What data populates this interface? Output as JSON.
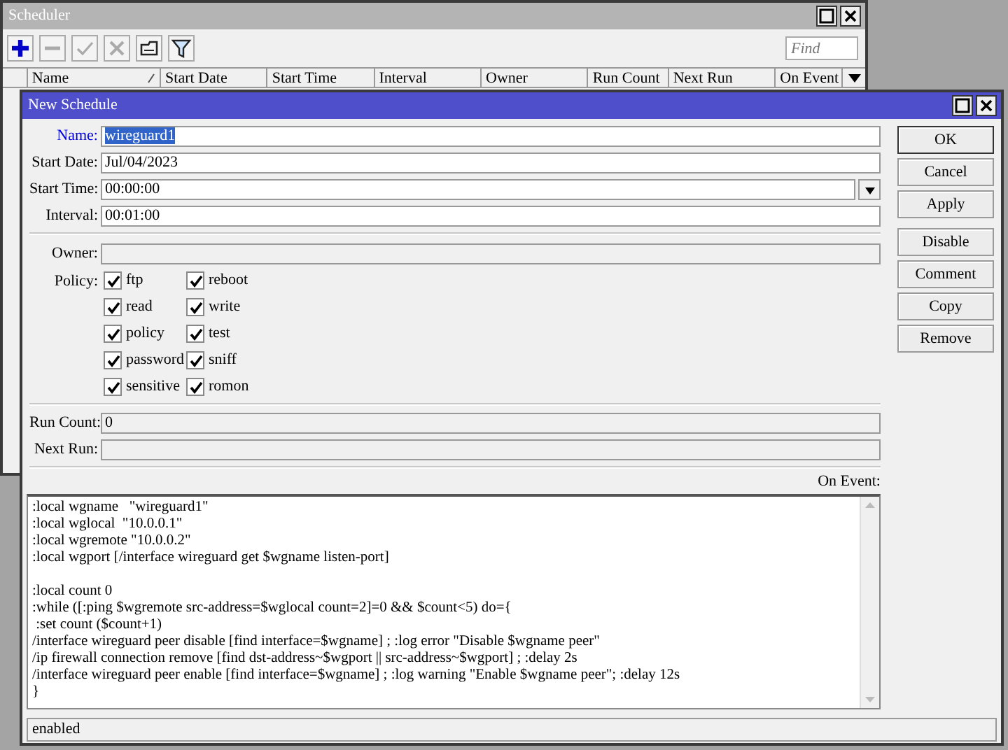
{
  "scheduler": {
    "title": "Scheduler",
    "toolbar": [
      {
        "kind": "add",
        "disabled": false
      },
      {
        "kind": "remove",
        "disabled": true
      },
      {
        "kind": "enable",
        "disabled": true
      },
      {
        "kind": "disable",
        "disabled": true
      },
      {
        "kind": "comment",
        "disabled": false
      },
      {
        "kind": "filter",
        "disabled": false
      }
    ],
    "search": {
      "placeholder": "Find"
    },
    "columns": [
      {
        "label": "Name",
        "sorted": true
      },
      {
        "label": "Start Date",
        "sorted": false
      },
      {
        "label": "Start Time",
        "sorted": false
      },
      {
        "label": "Interval",
        "sorted": false
      },
      {
        "label": "Owner",
        "sorted": false
      },
      {
        "label": "Run Count",
        "sorted": false
      },
      {
        "label": "Next Run",
        "sorted": false
      },
      {
        "label": "On Event",
        "sorted": false
      }
    ]
  },
  "dialog": {
    "title": "New Schedule",
    "fields": [
      {
        "label": "Name:",
        "value": "wireguard1",
        "kind": "text",
        "focused": true,
        "disabled": false
      },
      {
        "label": "Start Date:",
        "value": "Jul/04/2023",
        "kind": "text",
        "focused": false,
        "disabled": false
      },
      {
        "label": "Start Time:",
        "value": "00:00:00",
        "kind": "dropdown",
        "focused": false,
        "disabled": false
      },
      {
        "label": "Interval:",
        "value": "00:01:00",
        "kind": "text",
        "focused": false,
        "disabled": false
      }
    ],
    "owner": {
      "label": "Owner:",
      "disabled": true
    },
    "policy": {
      "label": "Policy:",
      "options": [
        {
          "label": "ftp",
          "checked": true
        },
        {
          "label": "reboot",
          "checked": true
        },
        {
          "label": "read",
          "checked": true
        },
        {
          "label": "write",
          "checked": true
        },
        {
          "label": "policy",
          "checked": true
        },
        {
          "label": "test",
          "checked": true
        },
        {
          "label": "password",
          "checked": true
        },
        {
          "label": "sniff",
          "checked": true
        },
        {
          "label": "sensitive",
          "checked": true
        },
        {
          "label": "romon",
          "checked": true
        }
      ]
    },
    "stats": [
      {
        "label": "Run Count:",
        "value": "0",
        "disabled": true
      },
      {
        "label": "Next Run:",
        "disabled": true
      }
    ],
    "on_event": {
      "label": "On Event:",
      "script": ":local wgname   \"wireguard1\"\n:local wglocal  \"10.0.0.1\"\n:local wgremote \"10.0.0.2\"\n:local wgport [/interface wireguard get $wgname listen-port]\n\n:local count 0\n:while ([:ping $wgremote src-address=$wglocal count=2]=0 && $count<5) do={\n :set count ($count+1)\n/interface wireguard peer disable [find interface=$wgname] ; :log error \"Disable $wgname peer\"\n/ip firewall connection remove [find dst-address~$wgport || src-address~$wgport] ; :delay 2s\n/interface wireguard peer enable [find interface=$wgname] ; :log warning \"Enable $wgname peer\"; :delay 12s\n}"
    },
    "button_groups": [
      [
        {
          "label": "OK",
          "default": true
        },
        {
          "label": "Cancel",
          "default": false
        },
        {
          "label": "Apply",
          "default": false
        }
      ],
      [
        {
          "label": "Disable",
          "default": false
        },
        {
          "label": "Comment",
          "default": false
        },
        {
          "label": "Copy",
          "default": false
        },
        {
          "label": "Remove",
          "default": false
        }
      ]
    ],
    "status": "enabled"
  }
}
